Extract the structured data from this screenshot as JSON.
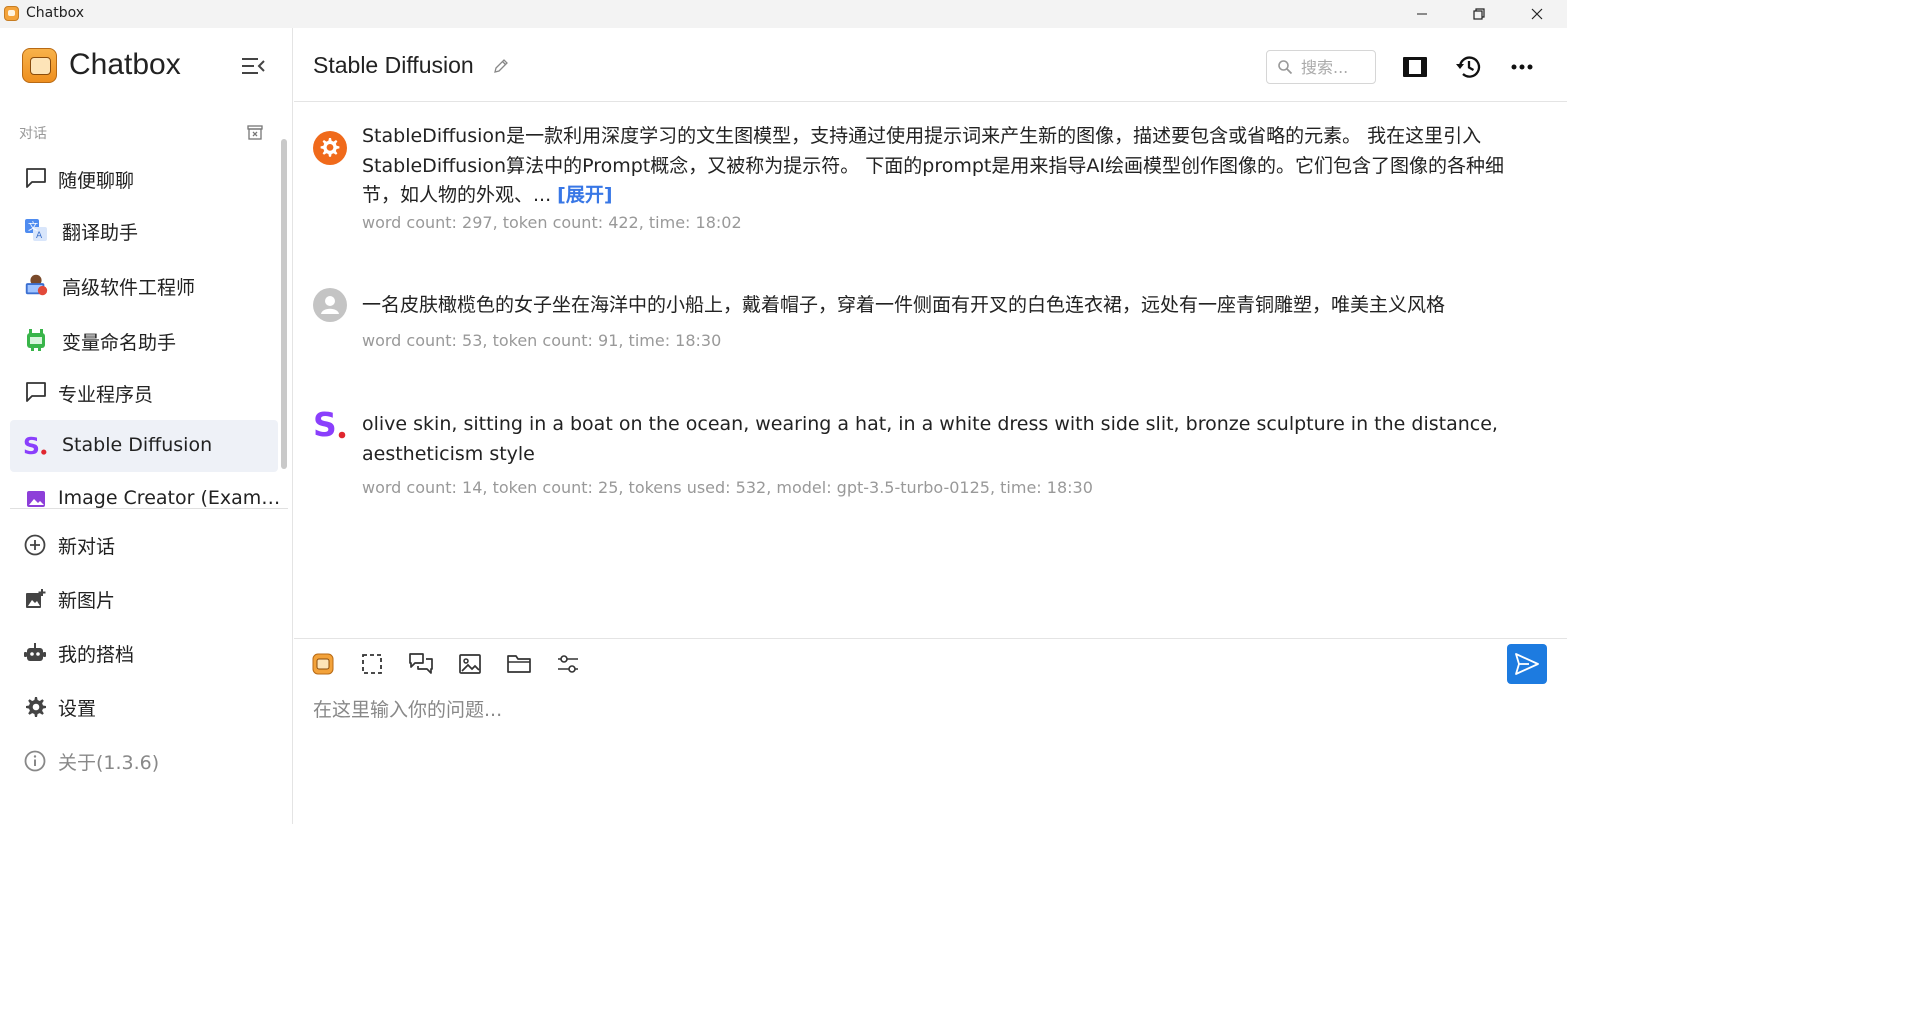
{
  "window": {
    "title": "Chatbox"
  },
  "sidebar": {
    "brand": "Chatbox",
    "section_label": "对话",
    "conversations": [
      {
        "label": "随便聊聊",
        "icon": "chat-bubble-icon"
      },
      {
        "label": "翻译助手",
        "icon": "translate-avatar-icon"
      },
      {
        "label": "高级软件工程师",
        "icon": "engineer-avatar-icon"
      },
      {
        "label": "变量命名助手",
        "icon": "robot-avatar-icon"
      },
      {
        "label": "专业程序员",
        "icon": "chat-bubble-icon"
      },
      {
        "label": "Stable Diffusion",
        "icon": "sd-logo-icon",
        "active": true
      },
      {
        "label": "Image Creator (Exam…",
        "icon": "image-icon"
      }
    ],
    "menu": [
      {
        "label": "新对话",
        "icon": "plus-circle-icon"
      },
      {
        "label": "新图片",
        "icon": "add-image-icon"
      },
      {
        "label": "我的搭档",
        "icon": "robot-icon"
      },
      {
        "label": "设置",
        "icon": "gear-icon"
      },
      {
        "label": "关于(1.3.6)",
        "icon": "info-icon"
      }
    ]
  },
  "header": {
    "title": "Stable Diffusion",
    "search_placeholder": "搜索..."
  },
  "messages": [
    {
      "role": "system",
      "text": "StableDiffusion是一款利用深度学习的文生图模型，支持通过使用提示词来产生新的图像，描述要包含或省略的元素。 我在这里引入StableDiffusion算法中的Prompt概念，又被称为提示符。 下面的prompt是用来指导AI绘画模型创作图像的。它们包含了图像的各种细节，如人物的外观、...",
      "expand_label": "[展开]",
      "meta": "word count: 297, token count: 422, time: 18:02"
    },
    {
      "role": "user",
      "text": "一名皮肤橄榄色的女子坐在海洋中的小船上，戴着帽子，穿着一件侧面有开叉的白色连衣裙，远处有一座青铜雕塑，唯美主义风格",
      "meta": "word count: 53, token count: 91, time: 18:30"
    },
    {
      "role": "assistant",
      "text": "olive skin, sitting in a boat on the ocean, wearing a hat, in a white dress with side slit, bronze sculpture in the distance, aestheticism style",
      "meta": "word count: 14, token count: 25, tokens used: 532, model: gpt-3.5-turbo-0125, time: 18:30"
    }
  ],
  "composer": {
    "placeholder": "在这里输入你的问题..."
  },
  "colors": {
    "accent": "#1d7be0",
    "system_avatar": "#f06a1b",
    "sd_purple": "#8a3ffc",
    "sd_red": "#e0262f",
    "active_bg": "#eef1f7"
  }
}
